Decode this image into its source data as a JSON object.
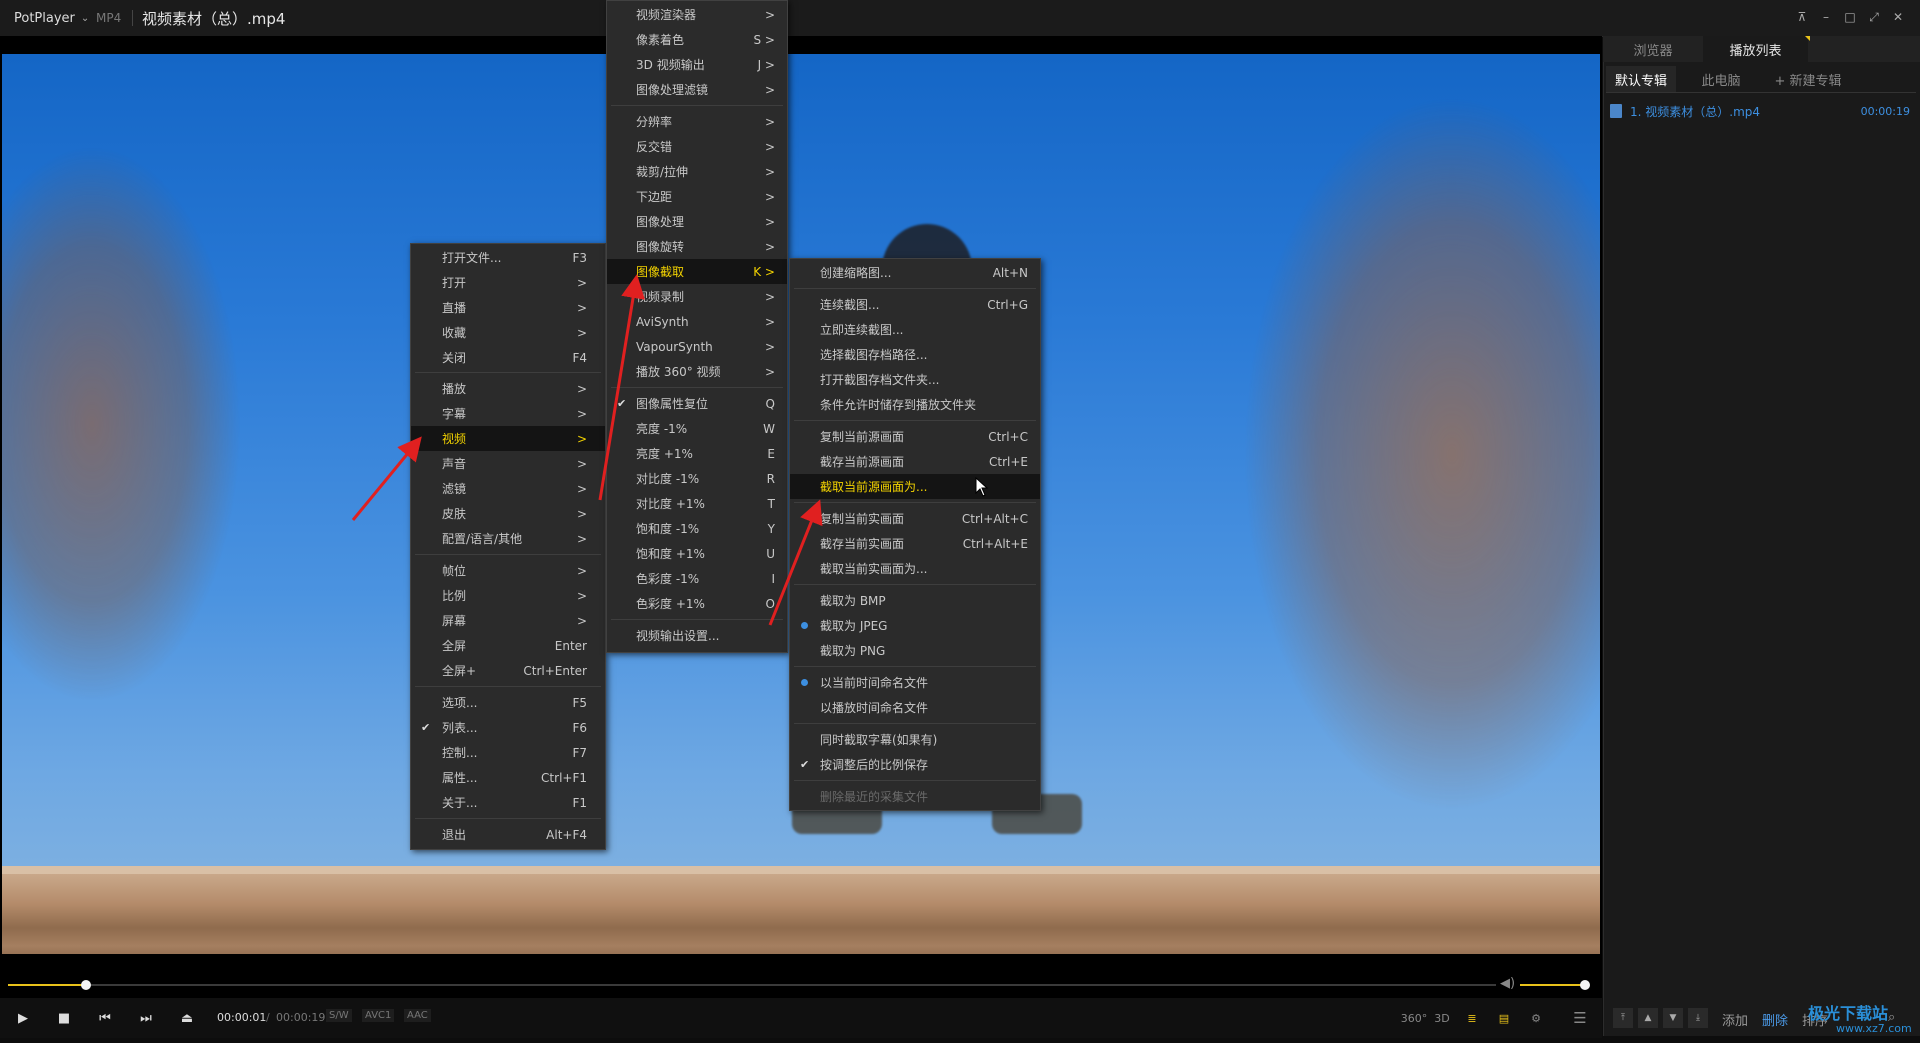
{
  "titlebar": {
    "app_name": "PotPlayer",
    "format": "MP4",
    "file_title": "视频素材（总）.mp4",
    "buttons": [
      "pin-icon",
      "minimize-icon",
      "maximize-icon",
      "fullscreen-icon",
      "close-icon"
    ]
  },
  "menu_main": {
    "items": [
      {
        "label": "打开文件...",
        "shortcut": "F3"
      },
      {
        "label": "打开",
        "shortcut": ">"
      },
      {
        "label": "直播",
        "shortcut": ">"
      },
      {
        "label": "收藏",
        "shortcut": ">"
      },
      {
        "label": "关闭",
        "shortcut": "F4"
      },
      {
        "label": "播放",
        "shortcut": ">"
      },
      {
        "label": "字幕",
        "shortcut": ">"
      },
      {
        "label": "视频",
        "shortcut": ">"
      },
      {
        "label": "声音",
        "shortcut": ">"
      },
      {
        "label": "滤镜",
        "shortcut": ">"
      },
      {
        "label": "皮肤",
        "shortcut": ">"
      },
      {
        "label": "配置/语言/其他",
        "shortcut": ">"
      },
      {
        "label": "帧位",
        "shortcut": ">"
      },
      {
        "label": "比例",
        "shortcut": ">"
      },
      {
        "label": "屏幕",
        "shortcut": ">"
      },
      {
        "label": "全屏",
        "shortcut": "Enter"
      },
      {
        "label": "全屏+",
        "shortcut": "Ctrl+Enter"
      },
      {
        "label": "选项...",
        "shortcut": "F5"
      },
      {
        "label": "列表...",
        "shortcut": "F6"
      },
      {
        "label": "控制...",
        "shortcut": "F7"
      },
      {
        "label": "属性...",
        "shortcut": "Ctrl+F1"
      },
      {
        "label": "关于...",
        "shortcut": "F1"
      },
      {
        "label": "退出",
        "shortcut": "Alt+F4"
      }
    ]
  },
  "menu_video": {
    "items": [
      {
        "label": "视频渲染器",
        "shortcut": ">"
      },
      {
        "label": "像素着色",
        "shortcut": "S >"
      },
      {
        "label": "3D 视频输出",
        "shortcut": "J >"
      },
      {
        "label": "图像处理滤镜",
        "shortcut": ">"
      },
      {
        "label": "分辨率",
        "shortcut": ">"
      },
      {
        "label": "反交错",
        "shortcut": ">"
      },
      {
        "label": "裁剪/拉伸",
        "shortcut": ">"
      },
      {
        "label": "下边距",
        "shortcut": ">"
      },
      {
        "label": "图像处理",
        "shortcut": ">"
      },
      {
        "label": "图像旋转",
        "shortcut": ">"
      },
      {
        "label": "图像截取",
        "shortcut": "K >"
      },
      {
        "label": "视频录制",
        "shortcut": ">"
      },
      {
        "label": "AviSynth",
        "shortcut": ">"
      },
      {
        "label": "VapourSynth",
        "shortcut": ">"
      },
      {
        "label": "播放 360° 视频",
        "shortcut": ">"
      },
      {
        "label": "图像属性复位",
        "shortcut": "Q"
      },
      {
        "label": "亮度 -1%",
        "shortcut": "W"
      },
      {
        "label": "亮度 +1%",
        "shortcut": "E"
      },
      {
        "label": "对比度 -1%",
        "shortcut": "R"
      },
      {
        "label": "对比度 +1%",
        "shortcut": "T"
      },
      {
        "label": "饱和度 -1%",
        "shortcut": "Y"
      },
      {
        "label": "饱和度 +1%",
        "shortcut": "U"
      },
      {
        "label": "色彩度 -1%",
        "shortcut": "I"
      },
      {
        "label": "色彩度 +1%",
        "shortcut": "O"
      },
      {
        "label": "视频输出设置...",
        "shortcut": ""
      }
    ]
  },
  "menu_capture": {
    "items": [
      {
        "label": "创建缩略图...",
        "shortcut": "Alt+N"
      },
      {
        "label": "连续截图...",
        "shortcut": "Ctrl+G"
      },
      {
        "label": "立即连续截图...",
        "shortcut": ""
      },
      {
        "label": "选择截图存档路径...",
        "shortcut": ""
      },
      {
        "label": "打开截图存档文件夹...",
        "shortcut": ""
      },
      {
        "label": "条件允许时储存到播放文件夹",
        "shortcut": ""
      },
      {
        "label": "复制当前源画面",
        "shortcut": "Ctrl+C"
      },
      {
        "label": "截存当前源画面",
        "shortcut": "Ctrl+E"
      },
      {
        "label": "截取当前源画面为...",
        "shortcut": ""
      },
      {
        "label": "复制当前实画面",
        "shortcut": "Ctrl+Alt+C"
      },
      {
        "label": "截存当前实画面",
        "shortcut": "Ctrl+Alt+E"
      },
      {
        "label": "截取当前实画面为...",
        "shortcut": ""
      },
      {
        "label": "截取为 BMP",
        "shortcut": ""
      },
      {
        "label": "截取为 JPEG",
        "shortcut": ""
      },
      {
        "label": "截取为 PNG",
        "shortcut": ""
      },
      {
        "label": "以当前时间命名文件",
        "shortcut": ""
      },
      {
        "label": "以播放时间命名文件",
        "shortcut": ""
      },
      {
        "label": "同时截取字幕(如果有)",
        "shortcut": ""
      },
      {
        "label": "按调整后的比例保存",
        "shortcut": ""
      },
      {
        "label": "删除最近的采集文件",
        "shortcut": ""
      }
    ]
  },
  "player": {
    "time_current": "00:00:01",
    "time_separator": "/",
    "time_total": "00:00:19",
    "tags": [
      "S/W",
      "AVC1",
      "AAC"
    ],
    "progress_fraction": 0.0526,
    "volume_fraction": 1.0,
    "right_icons": [
      "360°",
      "3D"
    ]
  },
  "playlist": {
    "tab_browser": "浏览器",
    "tab_playlist": "播放列表",
    "sub_default": "默认专辑",
    "sub_pc": "此电脑",
    "sub_new": "+ 新建专辑",
    "item_name": "1. 视频素材（总）.mp4",
    "item_duration": "00:00:19",
    "bottom_add": "添加",
    "bottom_delete": "删除",
    "bottom_sort": "排序"
  },
  "watermark": {
    "text": "极光下载站",
    "url_text": "www.xz7.com"
  },
  "colors": {
    "accent": "#e8c21a",
    "highlight_text": "#f2d200",
    "playlist_text": "#3d8fe0",
    "arrow": "#e02020"
  }
}
